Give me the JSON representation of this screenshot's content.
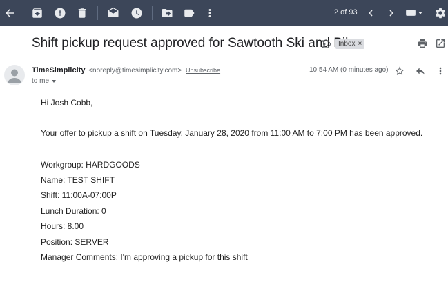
{
  "toolbar": {
    "icons": [
      "back-arrow-icon",
      "archive-icon",
      "report-spam-icon",
      "delete-icon",
      "mark-unread-icon",
      "snooze-icon",
      "move-to-icon",
      "label-icon",
      "more-vert-icon"
    ],
    "pager": "2 of 93",
    "settings_icon": "gear-icon"
  },
  "email": {
    "subject": "Shift pickup request approved for Sawtooth Ski and Bike",
    "label": "Inbox",
    "label_remove": "×",
    "sender": {
      "name": "TimeSimplicity",
      "email": "<noreply@timesimplicity.com>",
      "unsubscribe": "Unsubscribe",
      "to": "to me"
    },
    "timestamp": "10:54 AM (0 minutes ago)",
    "body": {
      "greeting": "Hi Josh Cobb,",
      "message": "Your offer to pickup a shift on Tuesday, January 28, 2020 from 11:00 AM to 7:00 PM has been approved.",
      "details": [
        "Workgroup: HARDGOODS",
        "Name: TEST SHIFT",
        "Shift: 11:00A-07:00P",
        "Lunch Duration: 0",
        "Hours: 8.00",
        "Position: SERVER",
        "Manager Comments: I'm approving a pickup for this shift"
      ]
    }
  }
}
